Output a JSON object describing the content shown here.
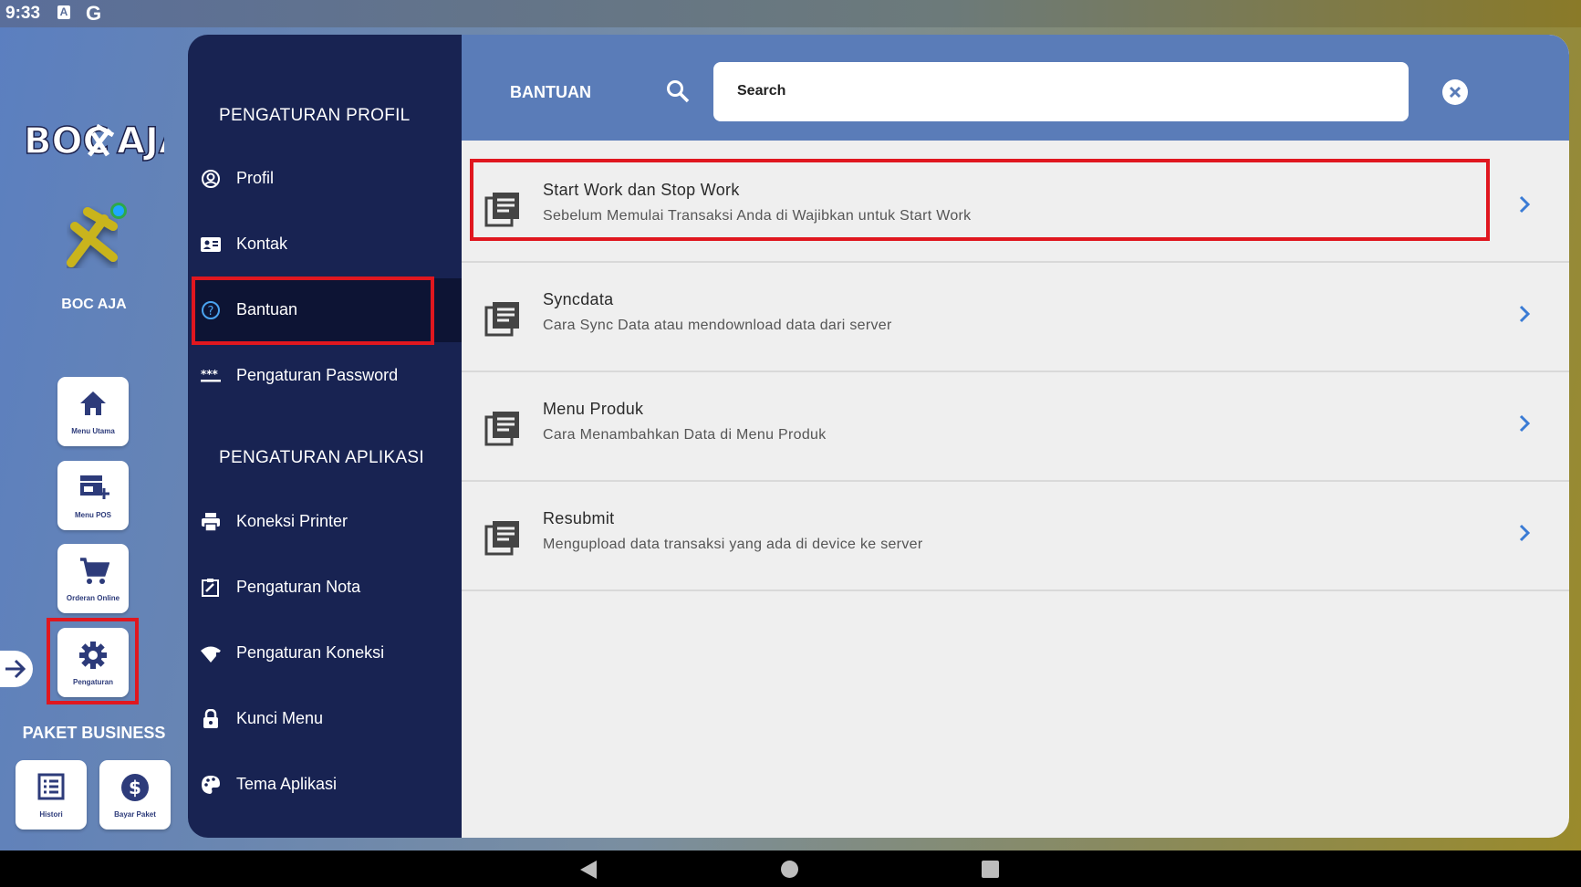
{
  "status_bar": {
    "time": "9:33",
    "icons": [
      "a-box-icon",
      "google-icon"
    ]
  },
  "rail": {
    "logo_text": "BOC⚒AJA",
    "user_name": "BOC AJA",
    "tiles": [
      {
        "label": "Menu Utama",
        "icon": "home-icon"
      },
      {
        "label": "Menu POS",
        "icon": "store-add-icon"
      },
      {
        "label": "Orderan Online",
        "icon": "cart-icon"
      },
      {
        "label": "Pengaturan",
        "icon": "gear-icon"
      }
    ],
    "section_label": "PAKET BUSINESS",
    "paket_tiles": [
      {
        "label": "Histori",
        "icon": "list-icon"
      },
      {
        "label": "Bayar Paket",
        "icon": "dollar-icon"
      }
    ]
  },
  "drawer": {
    "section_profile": "PENGATURAN PROFIL",
    "profile_items": [
      {
        "label": "Profil",
        "icon": "user-circle-icon"
      },
      {
        "label": "Kontak",
        "icon": "contact-card-icon"
      },
      {
        "label": "Bantuan",
        "icon": "help-icon"
      },
      {
        "label": "Pengaturan Password",
        "icon": "password-icon"
      }
    ],
    "section_app": "PENGATURAN APLIKASI",
    "app_items": [
      {
        "label": "Koneksi Printer",
        "icon": "printer-icon"
      },
      {
        "label": "Pengaturan Nota",
        "icon": "receipt-edit-icon"
      },
      {
        "label": "Pengaturan Koneksi",
        "icon": "wifi-alert-icon"
      },
      {
        "label": "Kunci Menu",
        "icon": "lock-icon"
      },
      {
        "label": "Tema Aplikasi",
        "icon": "palette-icon"
      }
    ]
  },
  "main": {
    "title": "BANTUAN",
    "search": {
      "placeholder": "Search"
    },
    "help_items": [
      {
        "title": "Start Work dan Stop Work",
        "subtitle": "Sebelum Memulai Transaksi Anda di Wajibkan untuk Start Work"
      },
      {
        "title": "Syncdata",
        "subtitle": "Cara Sync Data atau mendownload data dari server"
      },
      {
        "title": "Menu Produk",
        "subtitle": "Cara Menambahkan Data di Menu Produk"
      },
      {
        "title": "Resubmit",
        "subtitle": "Mengupload data transaksi yang ada di device ke server"
      }
    ]
  },
  "colors": {
    "drawer_bg": "#182352",
    "topbar_bg": "#5a7cb8",
    "highlight": "#e0171f",
    "chevron": "#3a7bd5"
  }
}
